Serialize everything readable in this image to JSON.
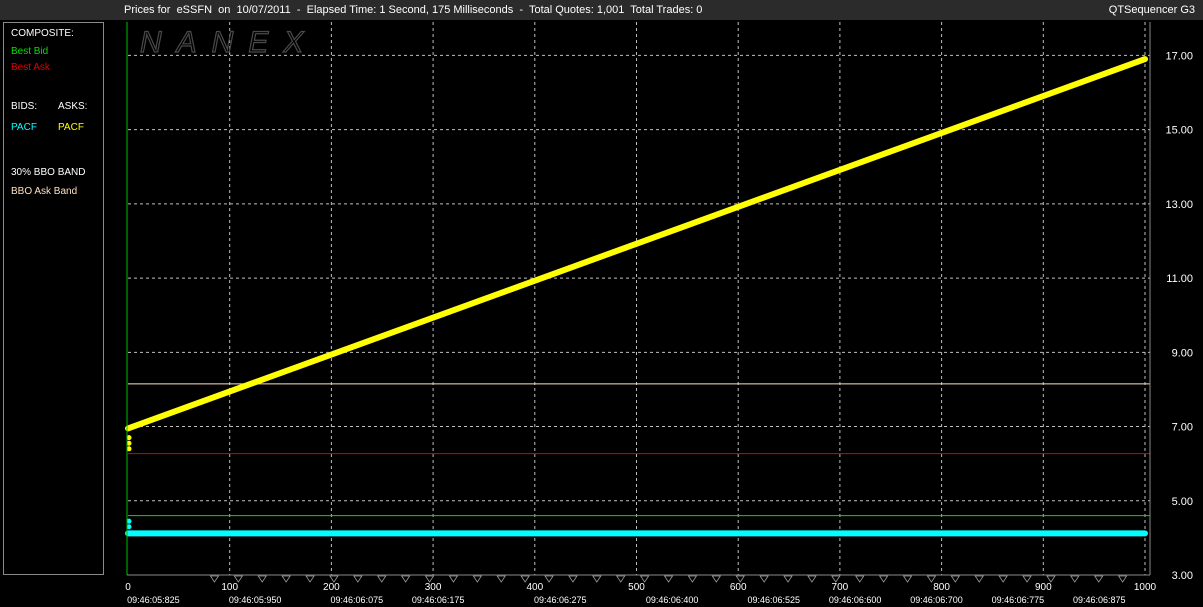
{
  "header": {
    "title": "Prices for  eSSFN  on  10/07/2011  -  Elapsed Time: 1 Second, 175 Milliseconds  -  Total Quotes: 1,001  Total Trades: 0",
    "app_name": "QTSequencer G3"
  },
  "watermark": "NANEX",
  "legend": {
    "composite_label": "COMPOSITE:",
    "best_bid": "Best Bid",
    "best_ask": "Best Ask",
    "bids_label": "BIDS:",
    "asks_label": "ASKS:",
    "bid_exchange": "PACF",
    "ask_exchange": "PACF",
    "band_label": "30% BBO BAND",
    "band_item": "BBO Ask Band"
  },
  "colors": {
    "background": "#000000",
    "grid": "#bfbfbf",
    "best_bid": "#00e000",
    "best_ask": "#e00000",
    "bid_series": "#00ffff",
    "ask_series": "#ffff00",
    "ask_band": "#ffe0c0"
  },
  "chart_data": {
    "type": "line",
    "title": "",
    "xlabel": "",
    "ylabel": "",
    "xlim": [
      0,
      1000
    ],
    "ylim": [
      3.0,
      17.9
    ],
    "x_ticks": [
      0,
      100,
      200,
      300,
      400,
      500,
      600,
      700,
      800,
      900,
      1000
    ],
    "y_ticks": [
      "3.00",
      "5.00",
      "7.00",
      "9.00",
      "11.00",
      "13.00",
      "15.00",
      "17.00"
    ],
    "y_tick_values": [
      3,
      5,
      7,
      9,
      11,
      13,
      15,
      17
    ],
    "time_labels": [
      {
        "x": 25,
        "label": "09:46:05:825"
      },
      {
        "x": 125,
        "label": "09:46:05:950"
      },
      {
        "x": 225,
        "label": "09:46:06:075"
      },
      {
        "x": 305,
        "label": "09:46:06:175"
      },
      {
        "x": 425,
        "label": "09:46:06:275"
      },
      {
        "x": 535,
        "label": "09:46:06:400"
      },
      {
        "x": 635,
        "label": "09:46:06:525"
      },
      {
        "x": 715,
        "label": "09:46:06:600"
      },
      {
        "x": 795,
        "label": "09:46:06:700"
      },
      {
        "x": 875,
        "label": "09:46:06:775"
      },
      {
        "x": 955,
        "label": "09:46:06:875"
      }
    ],
    "grid": true,
    "series": [
      {
        "name": "PACF",
        "side": "ask",
        "x": [
          0,
          1000
        ],
        "values": [
          6.95,
          16.9
        ]
      },
      {
        "name": "PACF",
        "side": "bid",
        "x": [
          0,
          1000
        ],
        "values": [
          4.12,
          4.12
        ]
      }
    ],
    "horizontal_lines": [
      {
        "name": "Best Bid",
        "value": 4.6
      },
      {
        "name": "Best Ask",
        "value": 6.27
      },
      {
        "name": "BBO Ask Band",
        "value": 8.15
      }
    ]
  }
}
